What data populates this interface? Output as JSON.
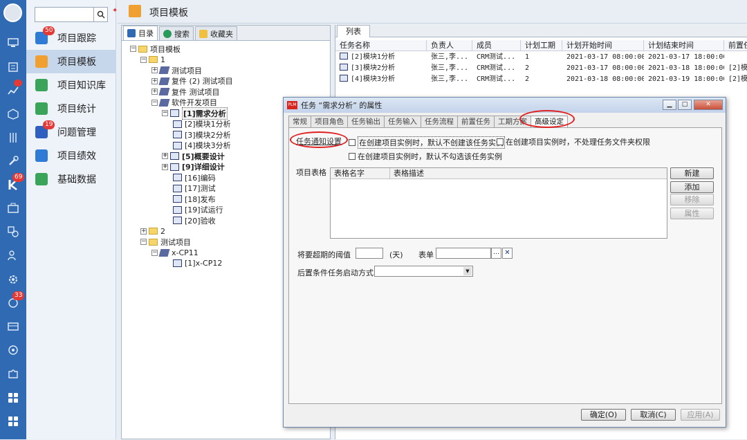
{
  "nav": {
    "search_placeholder": "",
    "items": [
      {
        "label": "项目跟踪",
        "badge": "50",
        "color": "#2f7bd6"
      },
      {
        "label": "项目模板",
        "badge": "",
        "color": "#f0a030"
      },
      {
        "label": "项目知识库",
        "badge": "",
        "color": "#3aa45a"
      },
      {
        "label": "项目统计",
        "badge": "",
        "color": "#3aa45a"
      },
      {
        "label": "问题管理",
        "badge": "19",
        "color": "#2f5fbf"
      },
      {
        "label": "项目绩效",
        "badge": "",
        "color": "#2f7bd6"
      },
      {
        "label": "基础数据",
        "badge": "",
        "color": "#3aa45a"
      }
    ]
  },
  "rail": {
    "badges": [
      "",
      "69",
      "33"
    ]
  },
  "header": {
    "title": "项目模板"
  },
  "tree_tabs": [
    "目录",
    "搜索",
    "收藏夹"
  ],
  "tree": [
    {
      "label": "项目模板",
      "type": "folder"
    },
    {
      "label": "1",
      "type": "folder"
    },
    {
      "label": "测试项目",
      "type": "proj"
    },
    {
      "label": "复件 (2) 测试项目",
      "type": "proj"
    },
    {
      "label": "复件 测试项目",
      "type": "proj"
    },
    {
      "label": "软件开发项目",
      "type": "proj"
    },
    {
      "label": "[1]需求分析",
      "type": "task"
    },
    {
      "label": "[2]模块1分析",
      "type": "task"
    },
    {
      "label": "[3]模块2分析",
      "type": "task"
    },
    {
      "label": "[4]模块3分析",
      "type": "task"
    },
    {
      "label": "[5]概要设计",
      "type": "task"
    },
    {
      "label": "[9]详细设计",
      "type": "task"
    },
    {
      "label": "[16]编码",
      "type": "task"
    },
    {
      "label": "[17]测试",
      "type": "task"
    },
    {
      "label": "[18]发布",
      "type": "task"
    },
    {
      "label": "[19]试运行",
      "type": "task"
    },
    {
      "label": "[20]验收",
      "type": "task"
    },
    {
      "label": "2",
      "type": "folder"
    },
    {
      "label": "测试项目",
      "type": "folder"
    },
    {
      "label": "x-CP11",
      "type": "proj"
    },
    {
      "label": "[1]x-CP12",
      "type": "task"
    }
  ],
  "list": {
    "tab": "列表",
    "headers": [
      "任务名称",
      "负责人",
      "成员",
      "计划工期",
      "计划开始时间",
      "计划结束时间",
      "前置任"
    ],
    "rows": [
      [
        "[2]模块1分析",
        "张三,李...",
        "CRM测试...",
        "1",
        "2021-03-17 08:00:00",
        "2021-03-17 18:00:00",
        ""
      ],
      [
        "[3]模块2分析",
        "张三,李...",
        "CRM测试...",
        "2",
        "2021-03-17 08:00:00",
        "2021-03-18 18:00:00",
        "[2]模"
      ],
      [
        "[4]模块3分析",
        "张三,李...",
        "CRM测试...",
        "2",
        "2021-03-18 08:00:00",
        "2021-03-19 18:00:00",
        "[2]模"
      ]
    ]
  },
  "dialog": {
    "title": "任务 “需求分析” 的属性",
    "tabs": [
      "常规",
      "项目角色",
      "任务输出",
      "任务输入",
      "任务流程",
      "前置任务",
      "工期方案",
      "高级设定"
    ],
    "notify_label": "任务通知设置",
    "cb1": "在创建项目实例时，默认不创建该任务实例",
    "cb2": "在创建项目实例时，不处理任务文件夹权限",
    "cb3": "在创建项目实例时，默认不勾选该任务实例",
    "table_label": "项目表格",
    "table_headers": [
      "表格名字",
      "表格描述"
    ],
    "btn_new": "新建",
    "btn_add": "添加",
    "btn_remove": "移除",
    "btn_prop": "属性",
    "threshold_label": "将要超期的阈值",
    "unit": "(天)",
    "form_label": "表单",
    "start_mode_label": "后置条件任务启动方式",
    "ok": "确定(O)",
    "cancel": "取消(C)",
    "apply": "应用(A)"
  }
}
